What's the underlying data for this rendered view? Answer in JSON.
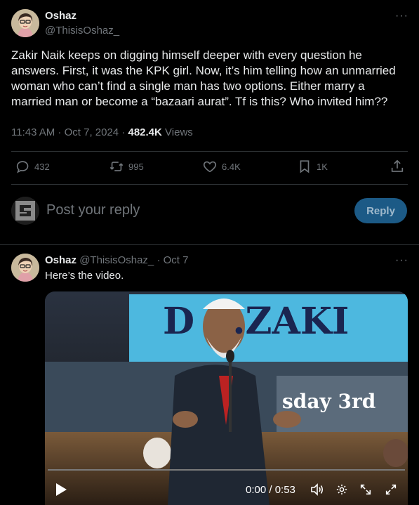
{
  "main_tweet": {
    "author_name": "Oshaz",
    "author_handle": "@ThisisOshaz_",
    "text": "Zakir Naik keeps on digging himself deeper with every question he answers. First, it was the KPK girl. Now, it’s him telling how an unmarried woman who can’t find a single man has two options. Either marry a married man or become a “bazaari aurat”. Tf is this? Who invited him??",
    "time": "11:43 AM · Oct 7, 2024 ·",
    "views_count": "482.4K",
    "views_label": "Views",
    "more": "···"
  },
  "actions": {
    "replies": "432",
    "reposts": "995",
    "likes": "6.4K",
    "bookmarks": "1K"
  },
  "reply_box": {
    "placeholder": "Post your reply",
    "button_label": "Reply"
  },
  "reply_tweet": {
    "author_name": "Oshaz",
    "author_handle": "@ThisisOshaz_",
    "date": "· Oct 7",
    "text": "Here’s the video.",
    "more": "···"
  },
  "video": {
    "banner_text": "D   .ZAKI",
    "banner_sub": "sday 3rd",
    "time_display": "0:00 / 0:53",
    "progress": 0
  },
  "colors": {
    "background": "#000000",
    "text_primary": "#e7e9ea",
    "text_secondary": "#71767b",
    "divider": "#2f3336",
    "reply_button_bg": "#1c5a86",
    "video_banner": "#4db8df"
  }
}
